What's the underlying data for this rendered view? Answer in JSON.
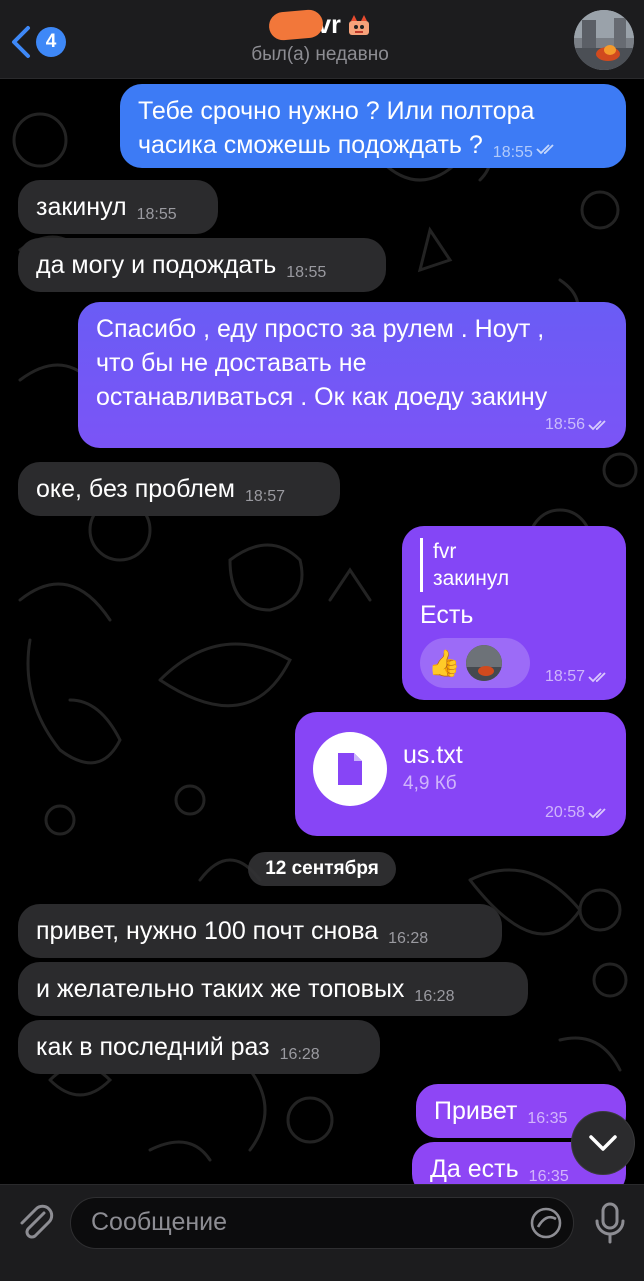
{
  "header": {
    "back_badge": "4",
    "title": "vr",
    "status": "был(а) недавно"
  },
  "colors": {
    "outgoing_top": "#3d7bf5",
    "outgoing_bottom": "#8b4af6",
    "incoming": "#2b2b2d",
    "accent": "#3e88f7"
  },
  "messages": [
    {
      "dir": "out",
      "lines": [
        "Тебе срочно нужно ? Или полтора",
        "часика сможешь подождать ?"
      ],
      "time": "18:55",
      "read": true
    },
    {
      "dir": "in",
      "text": "закинул",
      "time": "18:55"
    },
    {
      "dir": "in",
      "text": "да могу и подождать",
      "time": "18:55"
    },
    {
      "dir": "out",
      "lines": [
        "Спасибо , еду просто за рулем . Ноут ,",
        "что бы не доставать не",
        "останавливаться . Ок как доеду закину"
      ],
      "time": "18:56",
      "read": true
    },
    {
      "dir": "in",
      "text": "оке, без проблем",
      "time": "18:57"
    },
    {
      "dir": "out",
      "reply_author": "fvr",
      "reply_text": "закинул",
      "text": "Есть",
      "reaction_emoji": "👍",
      "time": "18:57",
      "read": true
    },
    {
      "dir": "out",
      "file_name": "us.txt",
      "file_size": "4,9 Кб",
      "time": "20:58",
      "read": true
    },
    {
      "dir": "in",
      "text": "привет, нужно 100 почт снова",
      "time": "16:28"
    },
    {
      "dir": "in",
      "text": "и желательно таких же топовых",
      "time": "16:28"
    },
    {
      "dir": "in",
      "text": "как в последний раз",
      "time": "16:28"
    },
    {
      "dir": "out",
      "text": "Привет",
      "time": "16:35",
      "read": true
    },
    {
      "dir": "out",
      "text": "Да есть",
      "time": "16:35",
      "read": true
    }
  ],
  "date_separator": "12 сентября",
  "composer": {
    "placeholder": "Сообщение"
  },
  "icons": [
    "chevron-left-icon",
    "attach-icon",
    "sticker-icon",
    "mic-icon",
    "chevron-down-icon",
    "file-icon",
    "double-check-icon"
  ]
}
